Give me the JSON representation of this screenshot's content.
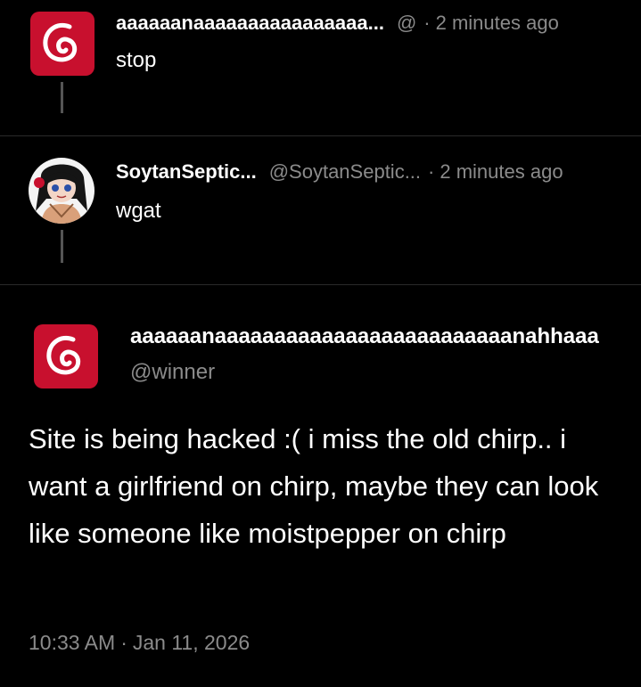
{
  "replies": [
    {
      "display_name": "aaaaaanaaaaaaaaaaaaaaaa...",
      "handle": "@",
      "separator": "·",
      "time": "2 minutes ago",
      "text": "stop",
      "avatar_icon": "debian-swirl-icon"
    },
    {
      "display_name": "SoytanSeptic...",
      "handle": "@SoytanSeptic...",
      "separator": "·",
      "time": "2 minutes ago",
      "text": "wgat",
      "avatar_icon": "anime-girl-avatar-icon"
    }
  ],
  "main_post": {
    "display_name": "aaaaaanaaaaaaaaaaaaaaaaaaaaaaaaanahhaaa",
    "handle": "@winner",
    "text": "Site is being hacked :( i miss the old chirp.. i want a girlfriend on chirp, maybe they can look like someone like moistpepper on chirp",
    "time": "10:33 AM",
    "separator": "·",
    "date": "Jan 11, 2026",
    "avatar_icon": "debian-swirl-icon"
  },
  "colors": {
    "background": "#000000",
    "text": "#ffffff",
    "muted": "#8b8b8b",
    "avatar_red": "#c8102e",
    "divider": "#2a2a2a"
  }
}
